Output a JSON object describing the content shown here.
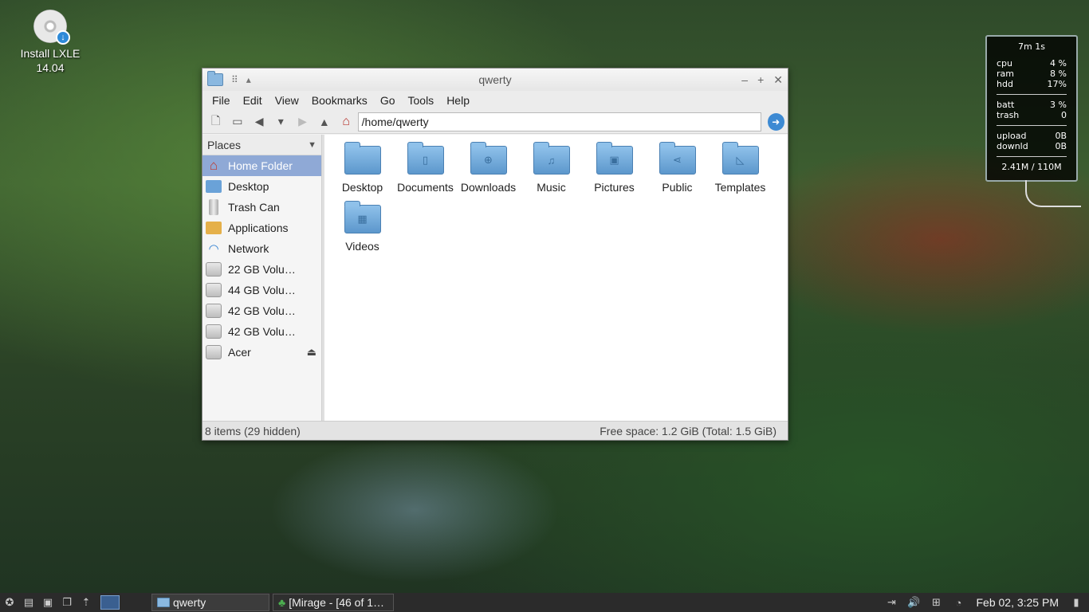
{
  "desktop": {
    "icon_label_line1": "Install LXLE",
    "icon_label_line2": "14.04"
  },
  "conky": {
    "uptime": "7m 1s",
    "stats": [
      {
        "label": "cpu",
        "value": "4 %"
      },
      {
        "label": "ram",
        "value": "8 %"
      },
      {
        "label": "hdd",
        "value": "17%"
      }
    ],
    "stats2": [
      {
        "label": "batt",
        "value": "3 %"
      },
      {
        "label": "trash",
        "value": "0"
      }
    ],
    "net": [
      {
        "label": "upload",
        "value": "0B"
      },
      {
        "label": "downld",
        "value": "0B"
      }
    ],
    "footer": "2.41M / 110M"
  },
  "window": {
    "title": "qwerty",
    "menu": [
      "File",
      "Edit",
      "View",
      "Bookmarks",
      "Go",
      "Tools",
      "Help"
    ],
    "path": "/home/qwerty",
    "places_header": "Places",
    "places": [
      {
        "label": "Home Folder",
        "icon": "home-icon"
      },
      {
        "label": "Desktop",
        "icon": "desktop-icon"
      },
      {
        "label": "Trash Can",
        "icon": "trash-icon"
      },
      {
        "label": "Applications",
        "icon": "applications-icon"
      },
      {
        "label": "Network",
        "icon": "network-icon"
      },
      {
        "label": "22 GB Volu…",
        "icon": "drive-icon"
      },
      {
        "label": "44 GB Volu…",
        "icon": "drive-icon"
      },
      {
        "label": "42 GB Volu…",
        "icon": "drive-icon"
      },
      {
        "label": "42 GB Volu…",
        "icon": "drive-icon"
      },
      {
        "label": "Acer",
        "icon": "drive-icon"
      }
    ],
    "files": [
      {
        "name": "Desktop",
        "glyph": ""
      },
      {
        "name": "Documents",
        "glyph": "▯"
      },
      {
        "name": "Downloads",
        "glyph": "⊕"
      },
      {
        "name": "Music",
        "glyph": "♫"
      },
      {
        "name": "Pictures",
        "glyph": "▣"
      },
      {
        "name": "Public",
        "glyph": "⋖"
      },
      {
        "name": "Templates",
        "glyph": "◺"
      },
      {
        "name": "Videos",
        "glyph": "▦"
      }
    ],
    "status_left": "8 items (29 hidden)",
    "status_right": "Free space: 1.2 GiB (Total: 1.5 GiB)"
  },
  "taskbar": {
    "task1": "qwerty",
    "task2": "[Mirage - [46 of 1…",
    "clock": "Feb 02,  3:25 PM"
  }
}
